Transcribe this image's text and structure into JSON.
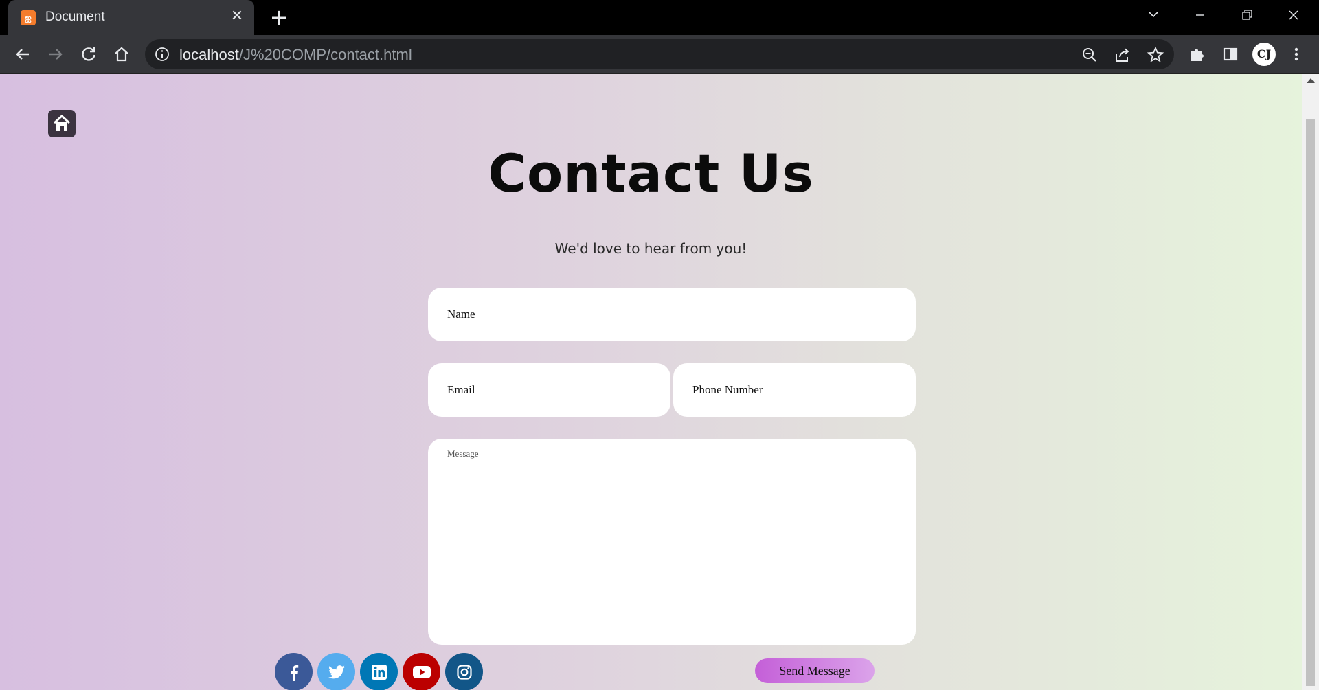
{
  "browser": {
    "tab_title": "Document",
    "favicon_label": "ஐ",
    "url_host": "localhost",
    "url_path": "/J%20COMP/contact.html",
    "avatar_initials": "CJ"
  },
  "page": {
    "title": "Contact Us",
    "subtitle": "We'd love to hear from you!",
    "form": {
      "name_placeholder": "Name",
      "email_placeholder": "Email",
      "phone_placeholder": "Phone Number",
      "message_placeholder": "Message",
      "name_value": "",
      "email_value": "",
      "phone_value": "",
      "message_value": "",
      "send_label": "Send Message"
    },
    "social": [
      {
        "name": "facebook-icon",
        "color": "#3b5998"
      },
      {
        "name": "twitter-icon",
        "color": "#55acee"
      },
      {
        "name": "linkedin-icon",
        "color": "#0077b5"
      },
      {
        "name": "youtube-icon",
        "color": "#bb0000"
      },
      {
        "name": "instagram-icon",
        "color": "#125688"
      }
    ],
    "colors": {
      "send_gradient_start": "#c45fd8",
      "send_gradient_end": "#dba3ea",
      "background_left": "#d7bfe0",
      "background_right": "#e6f3dc"
    }
  }
}
